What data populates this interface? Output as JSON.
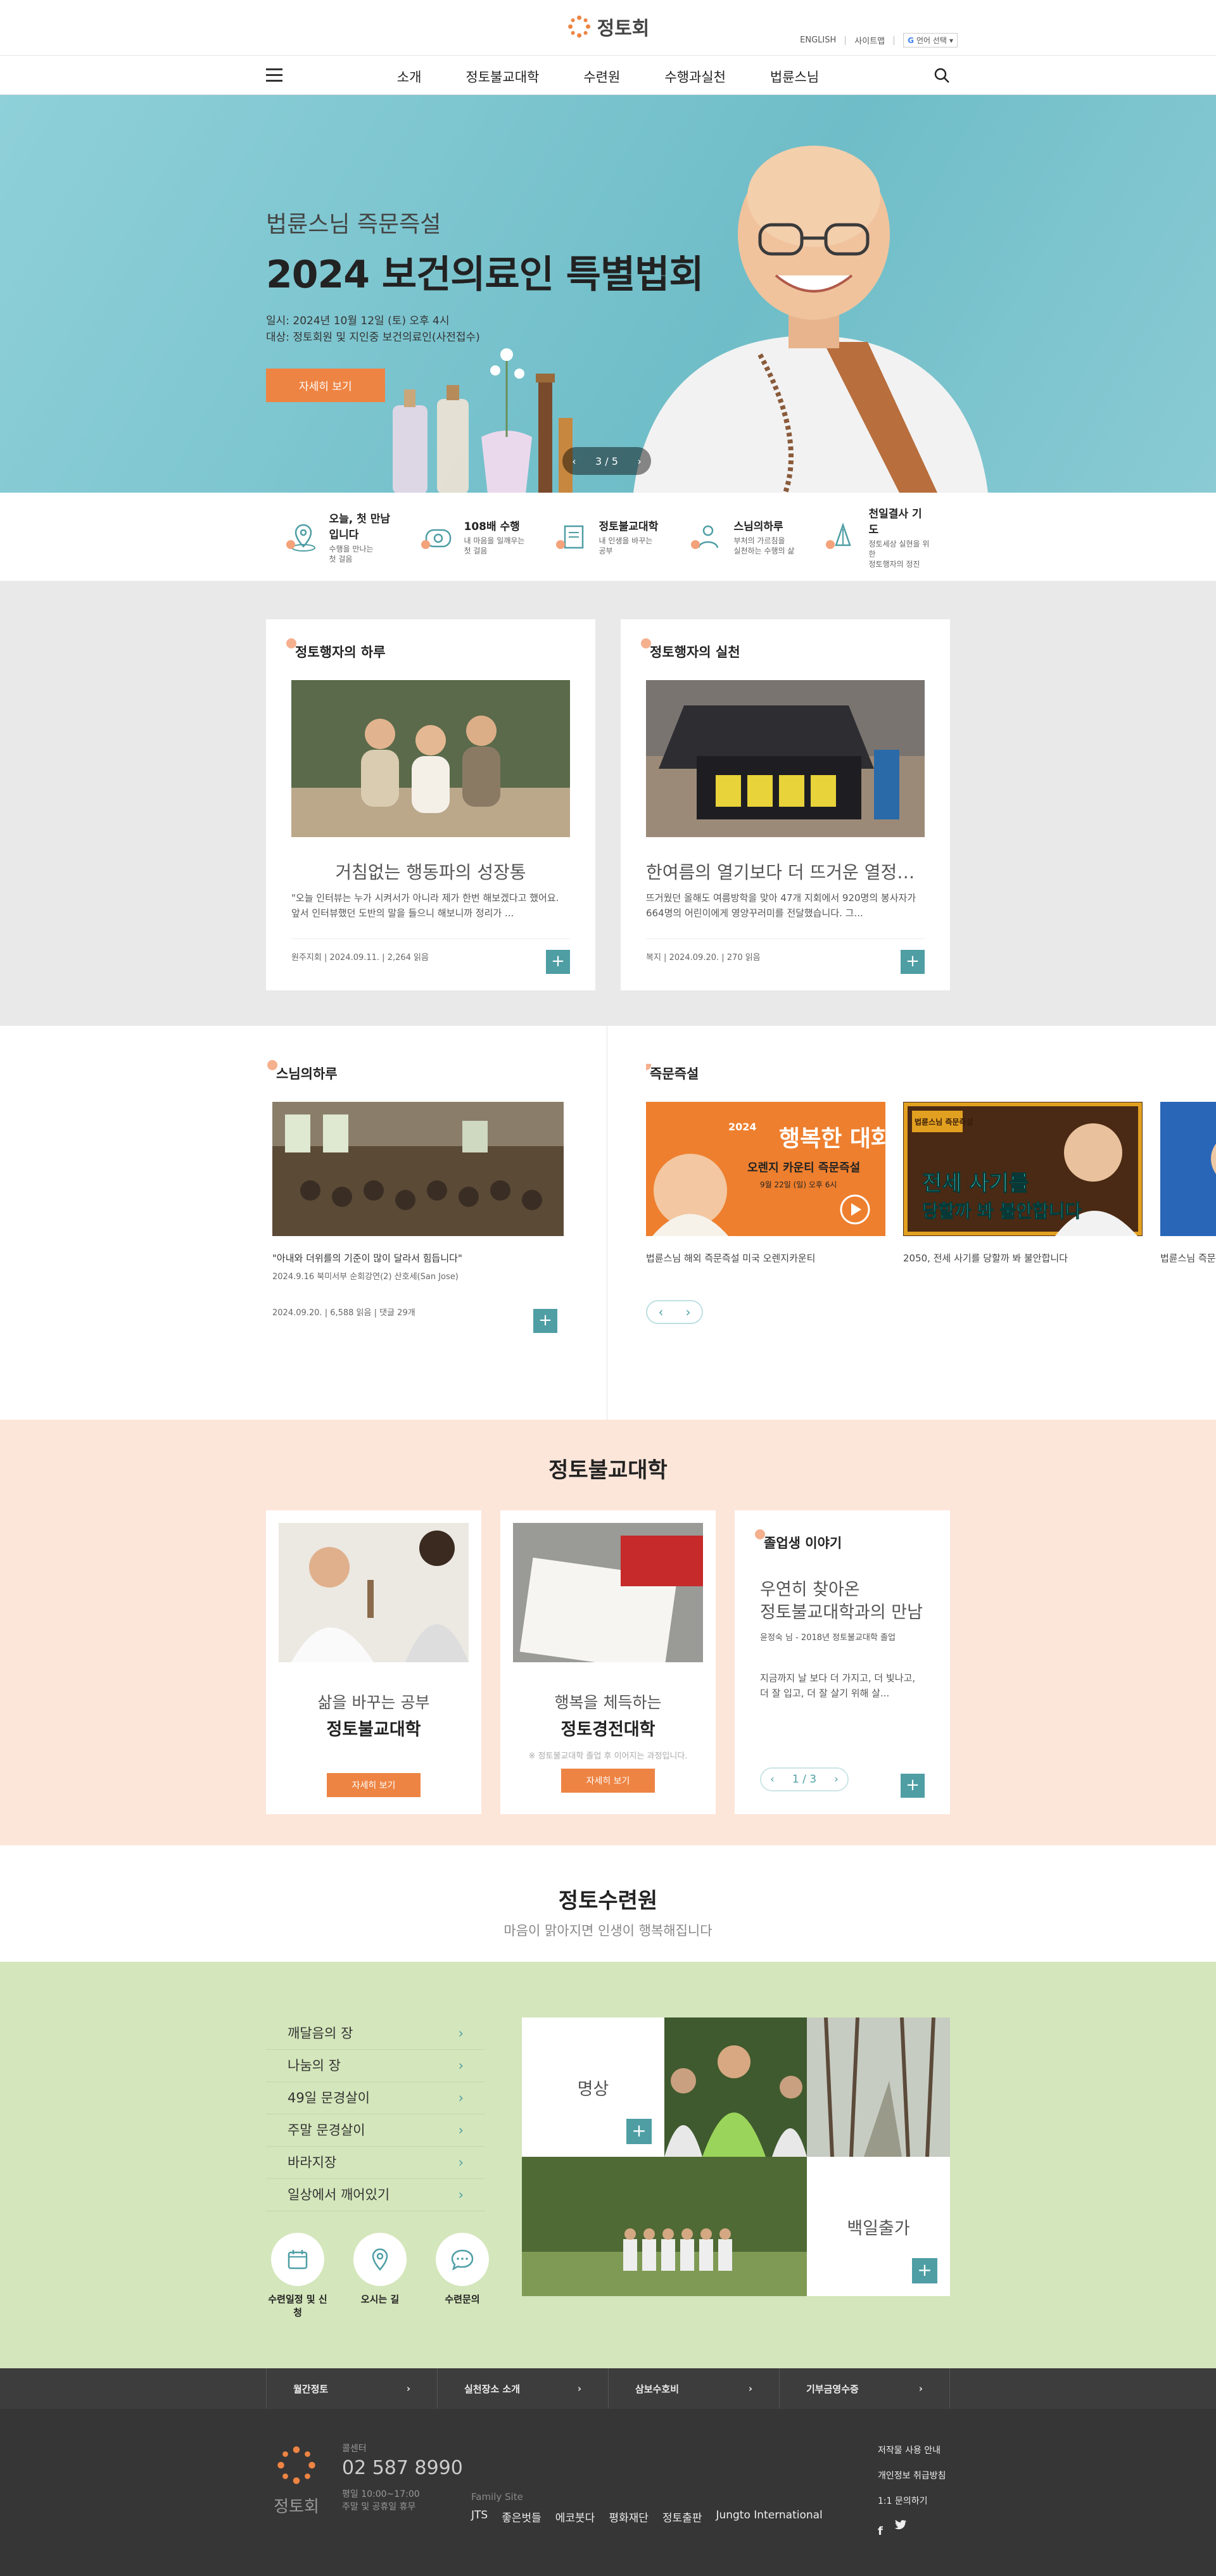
{
  "header": {
    "logo_text": "정토회",
    "links": [
      "ENGLISH",
      "사이트맵"
    ],
    "lang_label": "언어 선택",
    "nav": [
      "소개",
      "정토불교대학",
      "수련원",
      "수행과실천",
      "법륜스님"
    ]
  },
  "hero": {
    "subtitle": "법륜스님 즉문즉설",
    "title": "2024 보건의료인 특별법회",
    "date_line": "일시: 2024년 10월 12일 (토) 오후 4시",
    "target_line": "대상: 정토회원 및 지인중 보건의료인(사전접수)",
    "button": "자세히 보기",
    "pager": "3 / 5"
  },
  "quick": [
    {
      "title": "오늘, 첫 만남입니다",
      "desc1": "수행을 만나는",
      "desc2": "첫 걸음",
      "icon": "location-pin-icon"
    },
    {
      "title": "108배 수행",
      "desc1": "내 마음을 일깨우는",
      "desc2": "첫 걸음",
      "icon": "bowing-icon"
    },
    {
      "title": "정토불교대학",
      "desc1": "내 인생을 바꾸는",
      "desc2": "공부",
      "icon": "book-icon"
    },
    {
      "title": "스님의하루",
      "desc1": "부처의 가르침을",
      "desc2": "실천하는 수행의 삶",
      "icon": "person-icon"
    },
    {
      "title": "천일결사 기도",
      "desc1": "정토세상 실현을 위한",
      "desc2": "정토행자의 정진",
      "icon": "prayer-hands-icon"
    }
  ],
  "practice": [
    {
      "label": "정토행자의 하루",
      "headline": "거침없는 행동파의 성장통",
      "body": "\"오늘 인터뷰는 누가 시켜서가 아니라 제가 한번 해보겠다고 했어요. 앞서 인터뷰했던 도반의 말을 들으니 해보니까 정리가 ...",
      "meta": "원주지회 | 2024.09.11. | 2,264 읽음"
    },
    {
      "label": "정토행자의 실천",
      "headline": "한여름의 열기보다 더 뜨거운 열정으...",
      "body": "뜨거웠던 올해도 여름방학을 맞아 47개 지회에서 920명의 봉사자가 664명의 어린이에게 영양꾸러미를 전달했습니다. 그...",
      "meta": "복지 | 2024.09.20. | 270 읽음"
    }
  ],
  "monk_day": {
    "label": "스님의하루",
    "quote": "\"아내와 더위를의 기준이 많이 달라서 힘듭니다\"",
    "sub": "2024.9.16 북미서부 순회강연(2) 산호세(San Jose)",
    "meta": "2024.09.20. | 6,588 읽음 | 댓글 29개"
  },
  "qna": {
    "label": "즉문즉설",
    "videos": [
      {
        "caption": "법륜스님 해외 즉문즉설 미국 오렌지카운티",
        "poster_title": "행복한 대화",
        "poster_year": "2024",
        "poster_sub": "오렌지 카운티 즉문즉설",
        "poster_date": "9월 22일 (일) 오후 6시"
      },
      {
        "caption": "2050, 전세 사기를 당할까 봐 불안합니다",
        "poster_title": "전세 사기를",
        "poster_line2": "당할까 봐 불안합니다",
        "poster_badge": "법륜스님 즉문즉설"
      },
      {
        "caption": "법륜스님 즉문즉설"
      }
    ]
  },
  "university": {
    "title": "정토불교대학",
    "cards": [
      {
        "line1": "삶을 바꾸는 공부",
        "line2": "정토불교대학",
        "note": "",
        "button": "자세히 보기"
      },
      {
        "line1": "행복을 체득하는",
        "line2": "정토경전대학",
        "note": "※ 정토불교대학 졸업 후 이어지는 과정입니다.",
        "button": "자세히 보기"
      }
    ],
    "story": {
      "label": "졸업생 이야기",
      "title1": "우연히 찾아온",
      "title2": "정토불교대학과의 만남",
      "author": "윤정숙 님 - 2018년 정토불교대학 졸업",
      "body": "지금까지 날 보다 더 가지고, 더 빛나고, 더 잘 입고, 더 잘 살기 위해 살...",
      "pager": "1 / 3"
    }
  },
  "retreat": {
    "title": "정토수련원",
    "subtitle": "마음이 맑아지면 인생이 행복해집니다",
    "list": [
      "깨달음의 장",
      "나눔의 장",
      "49일 문경살이",
      "주말 문경살이",
      "바라지장",
      "일상에서 깨어있기"
    ],
    "buttons": [
      {
        "label": "수련일정 및 신청",
        "icon": "calendar-icon"
      },
      {
        "label": "오시는 길",
        "icon": "map-pin-icon"
      },
      {
        "label": "수련문의",
        "icon": "chat-bubble-icon"
      }
    ],
    "tiles": [
      "명상",
      "백일출가"
    ]
  },
  "footer_band": [
    "월간정토",
    "실천장소 소개",
    "삼보수호비",
    "기부금영수증"
  ],
  "footer": {
    "logo_text": "정토회",
    "center_label": "콜센터",
    "phone": "02 587 8990",
    "hours1": "평일 10:00~17:00",
    "hours2": "주말 및 공휴일 휴무",
    "family_label": "Family Site",
    "family": [
      "JTS",
      "좋은벗들",
      "에코붓다",
      "평화재단",
      "정토출판",
      "Jungto International"
    ],
    "right_links": [
      "저작물 사용 안내",
      "개인정보 취급방침",
      "1:1 문의하기"
    ]
  },
  "colors": {
    "accent": "#ee8443",
    "teal": "#4e9ea4",
    "peach_bg": "#fce5d9",
    "green_bg": "#d4e6bb",
    "gray_bg": "#e9e9e9",
    "footer_bg": "#363636"
  }
}
